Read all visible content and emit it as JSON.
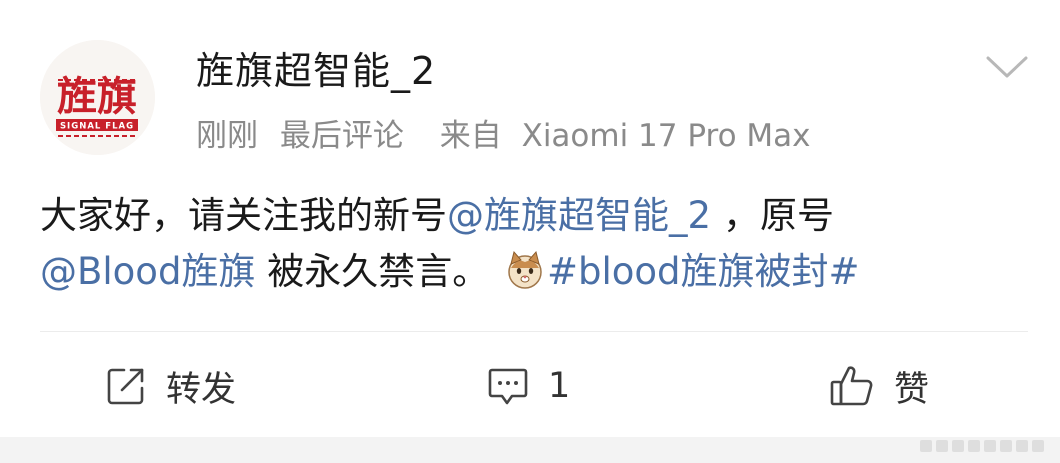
{
  "post": {
    "username": "旌旗超智能_2",
    "time": "刚刚",
    "sort": "最后评论",
    "source_prefix": "来自",
    "device": "Xiaomi 17 Pro Max",
    "content": {
      "line1_text": "大家好，请关注我的新号",
      "mention1": "@旌旗超智能_2",
      "line1_tail": "，原号",
      "mention2": "@Blood旌旗",
      "line2_text": " 被永久禁言。",
      "hashtag": "#blood旌旗被封#"
    }
  },
  "avatar": {
    "main_text": "旌旗",
    "sub_text": "SIGNAL FLAG",
    "color": "#c8202a"
  },
  "actions": {
    "repost_label": "转发",
    "comment_count": "1",
    "like_label": "赞"
  },
  "colors": {
    "link": "#4a6fa5",
    "text": "#1a1a1a",
    "meta": "#8a8a8a"
  },
  "icons": {
    "menu": "chevron-down-icon",
    "repost": "share-edit-icon",
    "comment": "comment-bubble-icon",
    "like": "thumbs-up-icon",
    "emoji": "cat-face-icon"
  }
}
